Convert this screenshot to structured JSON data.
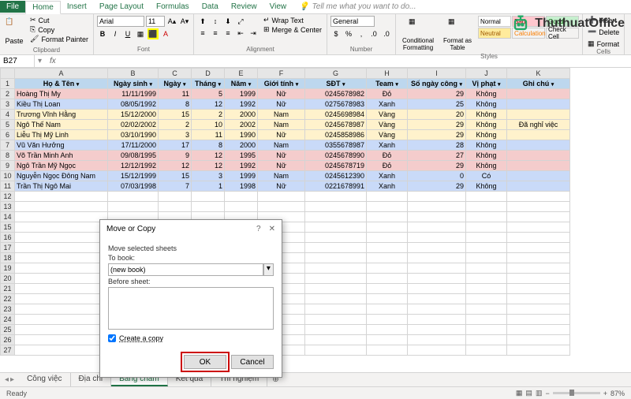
{
  "tabs": {
    "file": "File",
    "home": "Home",
    "insert": "Insert",
    "pagelayout": "Page Layout",
    "formulas": "Formulas",
    "data": "Data",
    "review": "Review",
    "view": "View",
    "tellme": "Tell me what you want to do..."
  },
  "ribbon": {
    "clipboard": {
      "paste": "Paste",
      "cut": "Cut",
      "copy": "Copy",
      "painter": "Format Painter",
      "label": "Clipboard"
    },
    "font": {
      "name": "Arial",
      "size": "11",
      "label": "Font"
    },
    "alignment": {
      "wrap": "Wrap Text",
      "merge": "Merge & Center",
      "label": "Alignment"
    },
    "number": {
      "format": "General",
      "label": "Number"
    },
    "styles": {
      "cond": "Conditional Formatting",
      "fmt": "Format as Table",
      "normal": "Normal",
      "bad": "Bad",
      "neutral": "Neutral",
      "calc": "Calculation",
      "good": "Good",
      "check": "Check Cell",
      "label": "Styles"
    },
    "cells": {
      "insert": "Insert",
      "delete": "Delete",
      "format": "Format",
      "label": "Cells"
    }
  },
  "namebox": "B27",
  "columns": [
    "A",
    "B",
    "C",
    "D",
    "E",
    "F",
    "G",
    "H",
    "I",
    "J",
    "K"
  ],
  "headers": {
    "A": "Họ & Tên",
    "B": "Ngày sinh",
    "C": "Ngày",
    "D": "Tháng",
    "E": "Năm",
    "F": "Giới tính",
    "G": "SĐT",
    "H": "Team",
    "I": "Số ngày công",
    "J": "Vị phạt",
    "K": "Ghi chú"
  },
  "rows": [
    {
      "n": 2,
      "cls": "row-red",
      "A": "Hoàng Thị My",
      "B": "11/11/1999",
      "C": "11",
      "D": "5",
      "E": "1999",
      "F": "Nữ",
      "G": "0245678982",
      "H": "Đỏ",
      "I": "29",
      "J": "Không",
      "K": ""
    },
    {
      "n": 3,
      "cls": "row-blue",
      "A": "Kiều Thị Loan",
      "B": "08/05/1992",
      "C": "8",
      "D": "12",
      "E": "1992",
      "F": "Nữ",
      "G": "0275678983",
      "H": "Xanh",
      "I": "25",
      "J": "Không",
      "K": ""
    },
    {
      "n": 4,
      "cls": "row-yellow",
      "A": "Trương Vĩnh Hằng",
      "B": "15/12/2000",
      "C": "15",
      "D": "2",
      "E": "2000",
      "F": "Nam",
      "G": "0245698984",
      "H": "Vàng",
      "I": "20",
      "J": "Không",
      "K": ""
    },
    {
      "n": 5,
      "cls": "row-yellow",
      "A": "Ngô Thế Nam",
      "B": "02/02/2002",
      "C": "2",
      "D": "10",
      "E": "2002",
      "F": "Nam",
      "G": "0245678987",
      "H": "Vàng",
      "I": "29",
      "J": "Không",
      "K": "Đã nghỉ việc"
    },
    {
      "n": 6,
      "cls": "row-yellow",
      "A": "Liễu Thị Mỹ Linh",
      "B": "03/10/1990",
      "C": "3",
      "D": "11",
      "E": "1990",
      "F": "Nữ",
      "G": "0245858986",
      "H": "Vàng",
      "I": "29",
      "J": "Không",
      "K": ""
    },
    {
      "n": 7,
      "cls": "row-blue",
      "A": "Vũ Văn Hưởng",
      "B": "17/11/2000",
      "C": "17",
      "D": "8",
      "E": "2000",
      "F": "Nam",
      "G": "0355678987",
      "H": "Xanh",
      "I": "28",
      "J": "Không",
      "K": ""
    },
    {
      "n": 8,
      "cls": "row-red",
      "A": "Võ Trần Minh Anh",
      "B": "09/08/1995",
      "C": "9",
      "D": "12",
      "E": "1995",
      "F": "Nữ",
      "G": "0245678990",
      "H": "Đỏ",
      "I": "27",
      "J": "Không",
      "K": ""
    },
    {
      "n": 9,
      "cls": "row-red",
      "A": "Ngô Trần Mỹ Ngọc",
      "B": "12/12/1992",
      "C": "12",
      "D": "12",
      "E": "1992",
      "F": "Nữ",
      "G": "0245678719",
      "H": "Đỏ",
      "I": "29",
      "J": "Không",
      "K": ""
    },
    {
      "n": 10,
      "cls": "row-blue",
      "A": "Nguyễn Ngọc Đông Nam",
      "B": "15/12/1999",
      "C": "15",
      "D": "3",
      "E": "1999",
      "F": "Nam",
      "G": "0245612390",
      "H": "Xanh",
      "I": "0",
      "J": "Có",
      "K": ""
    },
    {
      "n": 11,
      "cls": "row-blue",
      "A": "Trần Thị Ngô Mai",
      "B": "07/03/1998",
      "C": "7",
      "D": "1",
      "E": "1998",
      "F": "Nữ",
      "G": "0221678991",
      "H": "Xanh",
      "I": "29",
      "J": "Không",
      "K": ""
    }
  ],
  "empty_rows": [
    12,
    13,
    14,
    15,
    16,
    17,
    18,
    19,
    20,
    21,
    22,
    23,
    24,
    25,
    26,
    27
  ],
  "dialog": {
    "title": "Move or Copy",
    "move_label": "Move selected sheets",
    "tobook": "To book:",
    "book": "(new book)",
    "before": "Before sheet:",
    "copy": "Create a copy",
    "ok": "OK",
    "cancel": "Cancel"
  },
  "sheets": [
    "Công việc",
    "Địa chỉ",
    "Bảng chấm",
    "Kết quả",
    "Thí nghiệm"
  ],
  "active_sheet": 2,
  "status": {
    "ready": "Ready",
    "zoom": "87%"
  },
  "watermark": "ThuthuatOffice"
}
